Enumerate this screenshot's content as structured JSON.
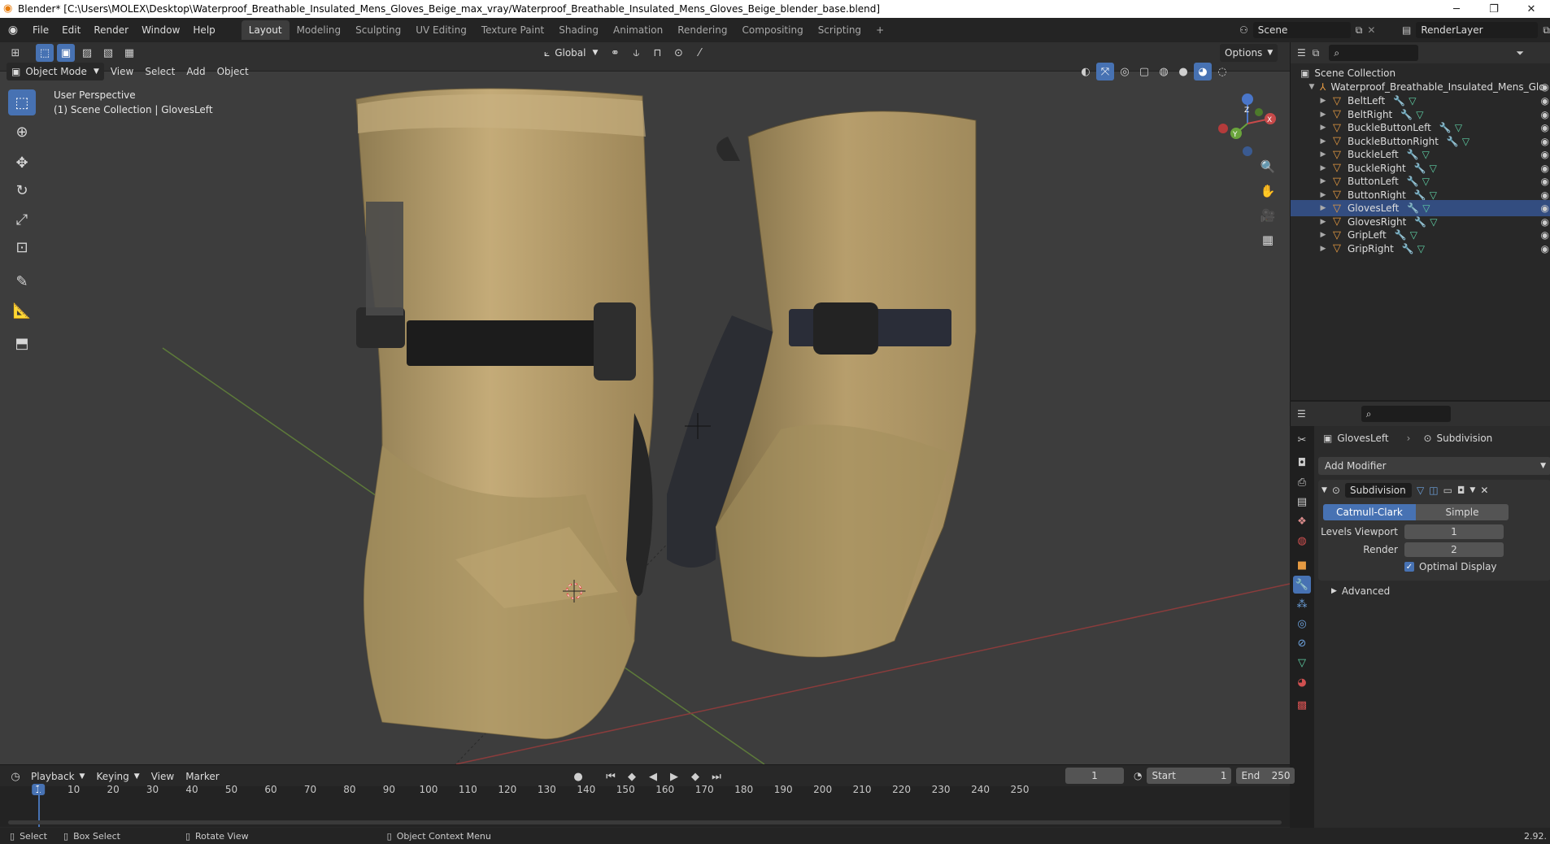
{
  "titlebar": {
    "title": "Blender* [C:\\Users\\MOLEX\\Desktop\\Waterproof_Breathable_Insulated_Mens_Gloves_Beige_max_vray/Waterproof_Breathable_Insulated_Mens_Gloves_Beige_blender_base.blend]",
    "minimize": "─",
    "maximize": "❐",
    "close": "✕"
  },
  "menu": {
    "items": [
      "File",
      "Edit",
      "Render",
      "Window",
      "Help"
    ],
    "workspaces": [
      "Layout",
      "Modeling",
      "Sculpting",
      "UV Editing",
      "Texture Paint",
      "Shading",
      "Animation",
      "Rendering",
      "Compositing",
      "Scripting"
    ],
    "active_workspace": "Layout",
    "add_tab": "+",
    "scene_label": "Scene",
    "renderlayer_label": "RenderLayer"
  },
  "viewport_header": {
    "mode": "Object Mode",
    "menus": [
      "View",
      "Select",
      "Add",
      "Object"
    ],
    "orientation": "Global",
    "options": "Options"
  },
  "viewport": {
    "perspective": "User Perspective",
    "collection_info": "(1) Scene Collection | GlovesLeft",
    "gizmo": {
      "x": "X",
      "y": "Y",
      "z": "Z"
    }
  },
  "outliner": {
    "root": "Scene Collection",
    "collection": "Waterproof_Breathable_Insulated_Mens_Glo",
    "objects": [
      "BeltLeft",
      "BeltRight",
      "BuckleButtonLeft",
      "BuckleButtonRight",
      "BuckleLeft",
      "BuckleRight",
      "ButtonLeft",
      "ButtonRight",
      "GlovesLeft",
      "GlovesRight",
      "GripLeft",
      "GripRight"
    ]
  },
  "properties": {
    "object_name": "GlovesLeft",
    "modifier_tab": "Subdivision",
    "add_modifier": "Add Modifier",
    "modifier_name": "Subdivision",
    "mode_catmull": "Catmull-Clark",
    "mode_simple": "Simple",
    "levels_viewport_label": "Levels Viewport",
    "levels_viewport_value": "1",
    "render_label": "Render",
    "render_value": "2",
    "optimal_display": "Optimal Display",
    "advanced": "Advanced"
  },
  "timeline": {
    "menus": [
      "Playback",
      "Keying",
      "View",
      "Marker"
    ],
    "current_frame": "1",
    "start_label": "Start",
    "start_value": "1",
    "end_label": "End",
    "end_value": "250",
    "ticks": [
      "1",
      "10",
      "20",
      "30",
      "40",
      "50",
      "60",
      "70",
      "80",
      "90",
      "100",
      "110",
      "120",
      "130",
      "140",
      "150",
      "160",
      "170",
      "180",
      "190",
      "200",
      "210",
      "220",
      "230",
      "240",
      "250"
    ]
  },
  "statusbar": {
    "select": "Select",
    "box_select": "Box Select",
    "rotate_view": "Rotate View",
    "context_menu": "Object Context Menu",
    "version": "2.92."
  },
  "colors": {
    "accent_blue": "#4772b3",
    "object_orange": "#e59a42",
    "mesh_green": "#5fd0a5",
    "modifier_blue": "#6da2de",
    "glove_beige": "#b39a68"
  }
}
